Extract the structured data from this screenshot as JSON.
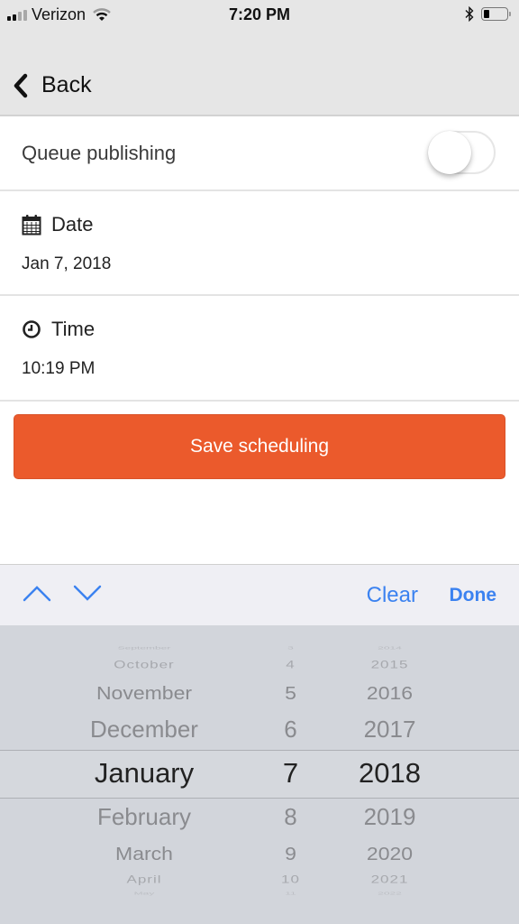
{
  "status_bar": {
    "carrier": "Verizon",
    "time": "7:20 PM",
    "signal_bars": 4,
    "signal_active": 2,
    "battery_level_percent": 25,
    "icons": [
      "signal-icon",
      "wifi-icon",
      "bluetooth-icon",
      "battery-icon"
    ]
  },
  "nav": {
    "back_label": "Back",
    "back_icon": "chevron-left-icon"
  },
  "queue": {
    "label": "Queue publishing",
    "enabled": false
  },
  "date_field": {
    "icon": "calendar-icon",
    "title": "Date",
    "value": "Jan 7, 2018"
  },
  "time_field": {
    "icon": "clock-icon",
    "title": "Time",
    "value": "10:19 PM"
  },
  "save_button": {
    "label": "Save scheduling",
    "color": "#eb5a2c"
  },
  "accessory": {
    "prev_icon": "chevron-up-icon",
    "next_icon": "chevron-down-icon",
    "clear_label": "Clear",
    "done_label": "Done",
    "accent_color": "#3b82f0"
  },
  "picker": {
    "months": [
      "September",
      "October",
      "November",
      "December",
      "January",
      "February",
      "March",
      "April",
      "May"
    ],
    "days": [
      "3",
      "4",
      "5",
      "6",
      "7",
      "8",
      "9",
      "10",
      "11"
    ],
    "years": [
      "2014",
      "2015",
      "2016",
      "2017",
      "2018",
      "2019",
      "2020",
      "2021",
      "2022"
    ],
    "selected": {
      "month": "January",
      "day": "7",
      "year": "2018"
    }
  }
}
